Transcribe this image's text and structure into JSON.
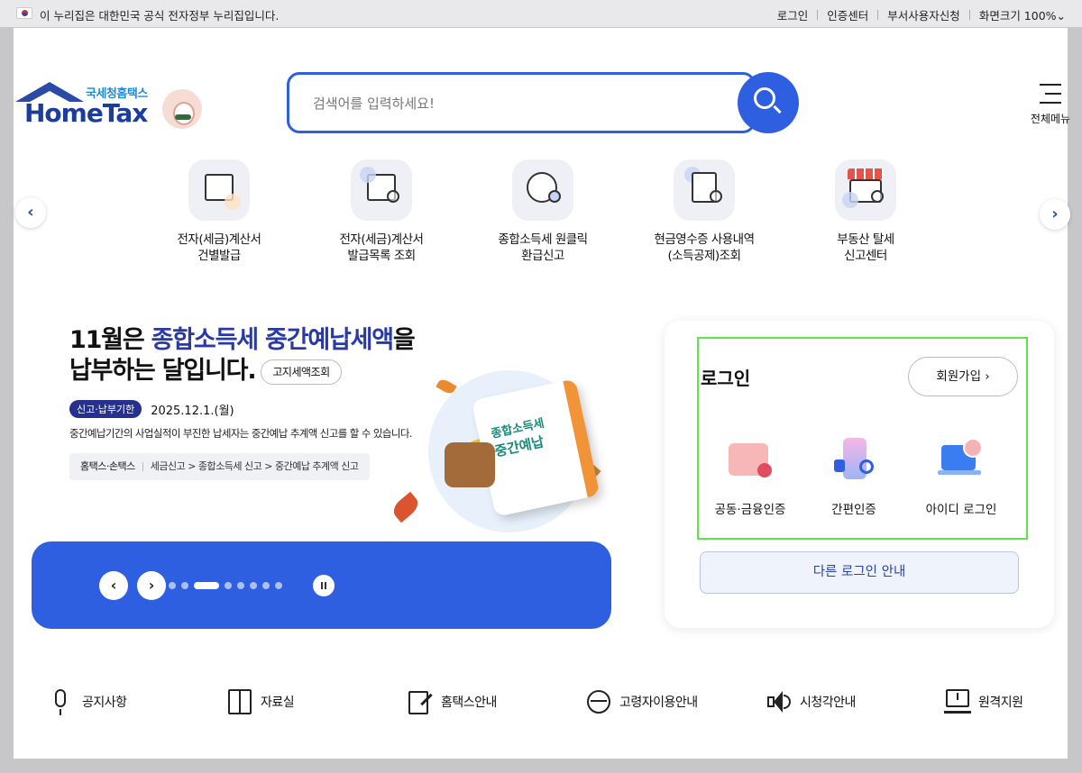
{
  "govbar": {
    "message": "이 누리집은 대한민국 공식 전자정부 누리집입니다.",
    "links": [
      "로그인",
      "인증센터",
      "부서사용자신청",
      "화면크기 100%⌄"
    ]
  },
  "header": {
    "logo_sub": "국세청홈택스",
    "logo_main": "HomeTax",
    "search_placeholder": "검색어를 입력하세요!",
    "menu_label": "전체메뉴"
  },
  "quick_menu": {
    "prev": "‹",
    "next": "›",
    "items": [
      {
        "label1": "전자(세금)계산서",
        "label2": "건별발급",
        "icon": "tax-envelope-icon"
      },
      {
        "label1": "전자(세금)계산서",
        "label2": "발급목록 조회",
        "icon": "tax-search-icon"
      },
      {
        "label1": "종합소득세 원클릭",
        "label2": "환급신고",
        "icon": "money-bag-icon"
      },
      {
        "label1": "현금영수증 사용내역",
        "label2": "(소득공제)조회",
        "icon": "receipt-search-icon"
      },
      {
        "label1": "부동산 탈세",
        "label2": "신고센터",
        "icon": "shop-search-icon"
      }
    ]
  },
  "banner": {
    "line1_plain": "11월은 ",
    "line1_highlight": "종합소득세 중간예납세액",
    "line1_end": "을",
    "line2": "납부하는 달입니다.",
    "check_button": "고지세액조회",
    "deadline_tag": "신고·납부기한",
    "deadline_date": "2025.12.1.(월)",
    "description": "중간예납기간의 사업실적이 부진한 납세자는 중간예납 추계액 신고를 할 수 있습니다.",
    "path_label": "홈택스·손택스",
    "path": "세금신고 > 종합소득세 신고 > 중간예납 추계액 신고",
    "calendar_line1": "종합소득세",
    "calendar_line2": "중간예납",
    "accent_color": "#2d5fe0"
  },
  "pager": {
    "prev": "‹",
    "next": "›",
    "slide_count": 8,
    "active_index": 2
  },
  "login": {
    "title": "로그인",
    "join_button": "회원가입 ›",
    "options": [
      "공동·금융인증",
      "간편인증",
      "아이디 로그인"
    ],
    "other_button": "다른 로그인 안내"
  },
  "bottom_nav": [
    "공지사항",
    "자료실",
    "홈택스안내",
    "고령자이용안내",
    "시청각안내",
    "원격지원"
  ]
}
